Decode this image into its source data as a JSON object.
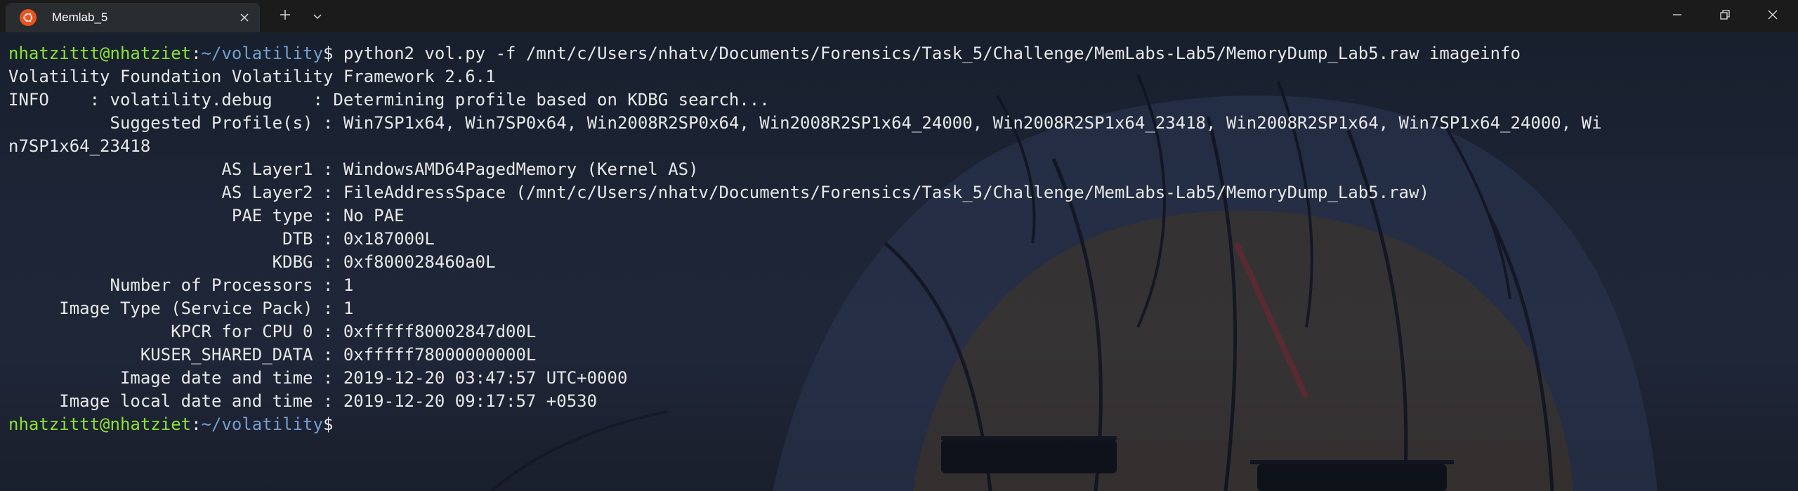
{
  "tab": {
    "title": "Memlab_5",
    "icon": "ubuntu-icon",
    "accent": "#e95420"
  },
  "toolbar": {
    "new_tab_icon": "plus-icon",
    "dropdown_icon": "chevron-down-icon"
  },
  "window_controls": [
    "minimize-icon",
    "restore-icon",
    "close-icon"
  ],
  "colors": {
    "prompt_user": "#8ae234",
    "prompt_path": "#729fcf",
    "text": "#e8e8e8"
  },
  "terminal": {
    "prompt_user": "nhatzittt@nhatziet",
    "prompt_path": "~/volatility",
    "prompt_symbol": "$",
    "command": " python2 vol.py -f /mnt/c/Users/nhatv/Documents/Forensics/Task_5/Challenge/MemLabs-Lab5/MemoryDump_Lab5.raw imageinfo",
    "output": [
      "Volatility Foundation Volatility Framework 2.6.1",
      "INFO    : volatility.debug    : Determining profile based on KDBG search...",
      "          Suggested Profile(s) : Win7SP1x64, Win7SP0x64, Win2008R2SP0x64, Win2008R2SP1x64_24000, Win2008R2SP1x64_23418, Win2008R2SP1x64, Win7SP1x64_24000, Wi",
      "n7SP1x64_23418",
      "                     AS Layer1 : WindowsAMD64PagedMemory (Kernel AS)",
      "                     AS Layer2 : FileAddressSpace (/mnt/c/Users/nhatv/Documents/Forensics/Task_5/Challenge/MemLabs-Lab5/MemoryDump_Lab5.raw)",
      "                      PAE type : No PAE",
      "                           DTB : 0x187000L",
      "                          KDBG : 0xf800028460a0L",
      "          Number of Processors : 1",
      "     Image Type (Service Pack) : 1",
      "                KPCR for CPU 0 : 0xfffff80002847d00L",
      "             KUSER_SHARED_DATA : 0xfffff78000000000L",
      "           Image date and time : 2019-12-20 03:47:57 UTC+0000",
      "     Image local date and time : 2019-12-20 09:17:57 +0530"
    ],
    "final_prompt_user": "nhatzittt@nhatziet",
    "final_prompt_path": "~/volatility",
    "final_prompt_symbol": "$"
  }
}
